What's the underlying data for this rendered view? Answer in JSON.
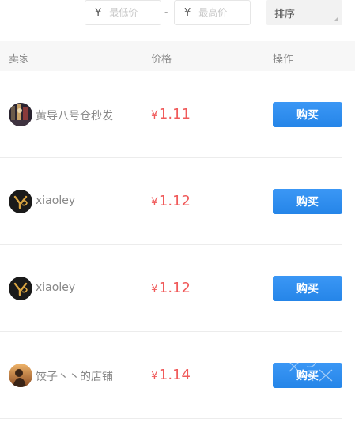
{
  "filters": {
    "currency_symbol": "¥",
    "min_price_placeholder": "最低价",
    "max_price_placeholder": "最高价",
    "separator": "-",
    "sort_label": "排序"
  },
  "table": {
    "headers": {
      "seller": "卖家",
      "price": "价格",
      "action": "操作"
    },
    "rows": [
      {
        "seller": "黄导八号仓秒发",
        "currency": "¥",
        "price": "1.11",
        "button": "购买",
        "avatar_icon": "photo-avatar-icon"
      },
      {
        "seller": "xiaoley",
        "currency": "¥",
        "price": "1.12",
        "button": "购买",
        "avatar_icon": "logo-avatar-icon"
      },
      {
        "seller": "xiaoley",
        "currency": "¥",
        "price": "1.12",
        "button": "购买",
        "avatar_icon": "logo-avatar-icon"
      },
      {
        "seller": "饺子丶丶的店铺",
        "currency": "¥",
        "price": "1.14",
        "button": "购买",
        "avatar_icon": "silhouette-avatar-icon"
      }
    ]
  },
  "colors": {
    "price_red": "#f05a5a",
    "button_blue": "#2d8cf0",
    "header_bg": "#f7f7f7"
  }
}
